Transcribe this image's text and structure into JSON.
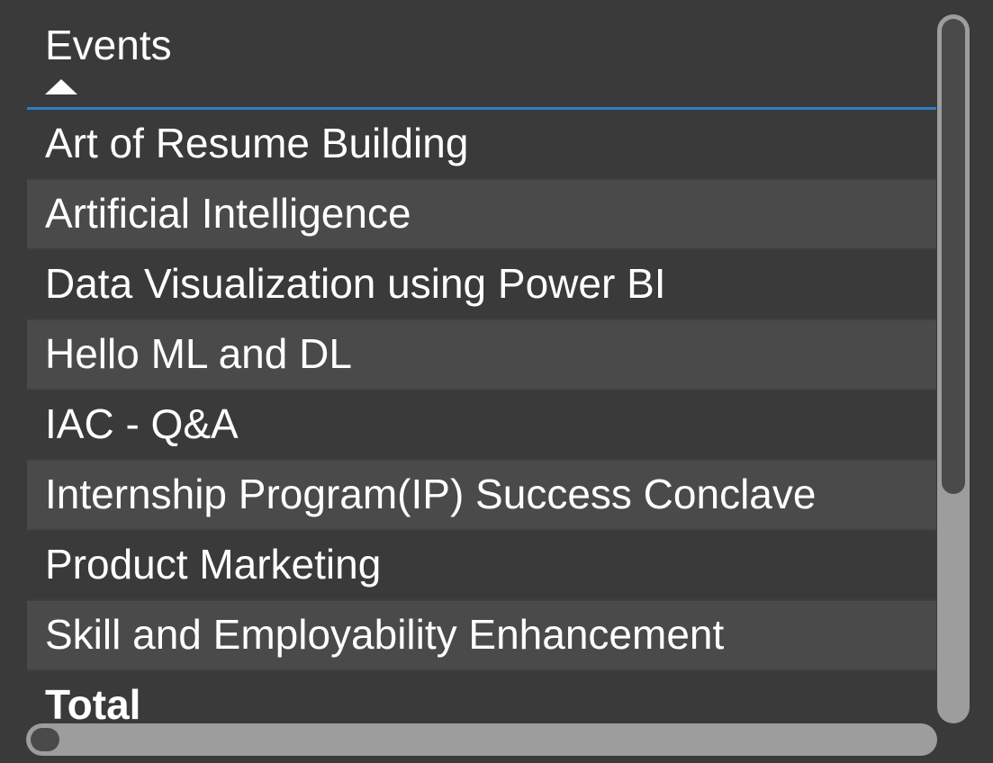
{
  "table": {
    "column_header": "Events",
    "sort_direction": "ascending",
    "sort_icon": "sort-ascending-triangle-icon",
    "header_underline_color": "#2f7fc7",
    "rows": [
      "Art of Resume Building",
      "Artificial Intelligence",
      "Data Visualization using Power BI",
      "Hello ML and DL",
      "IAC - Q&A",
      "Internship Program(IP) Success Conclave",
      "Product Marketing",
      "Skill and Employability Enhancement"
    ],
    "total_label": "Total"
  },
  "scrollbars": {
    "vertical_position": 0,
    "horizontal_position": 0
  }
}
